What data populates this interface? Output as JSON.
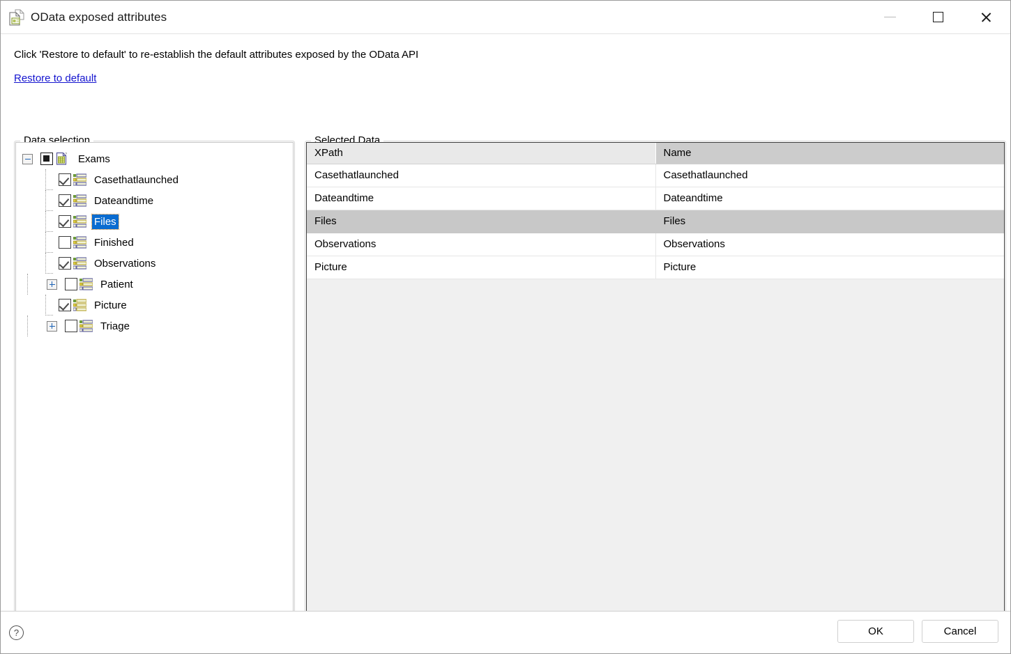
{
  "window": {
    "title": "OData exposed attributes",
    "icon": "document-card-icon",
    "controls": {
      "minimize_label": "Minimize",
      "maximize_label": "Maximize",
      "close_label": "Close"
    }
  },
  "instruction": "Click 'Restore to default' to re-establish the default attributes exposed by the OData API",
  "restore_link": "Restore to default",
  "data_selection": {
    "legend": "Data selection",
    "tree": [
      {
        "label": "Exams",
        "level": 0,
        "twisty": "minus",
        "checkbox": "partial",
        "icon": "table-document-icon",
        "selected": false
      },
      {
        "label": "Casethatlaunched",
        "level": 1,
        "twisty": "none",
        "checkbox": "checked",
        "icon": "attribute-list-icon",
        "selected": false
      },
      {
        "label": "Dateandtime",
        "level": 1,
        "twisty": "none",
        "checkbox": "checked",
        "icon": "attribute-list-icon",
        "selected": false
      },
      {
        "label": "Files",
        "level": 1,
        "twisty": "none",
        "checkbox": "checked",
        "icon": "attribute-list-icon",
        "selected": true
      },
      {
        "label": "Finished",
        "level": 1,
        "twisty": "none",
        "checkbox": "unchecked",
        "icon": "attribute-list-icon",
        "selected": false
      },
      {
        "label": "Observations",
        "level": 1,
        "twisty": "none",
        "checkbox": "checked",
        "icon": "attribute-list-icon",
        "selected": false
      },
      {
        "label": "Patient",
        "level": 1,
        "twisty": "plus",
        "checkbox": "unchecked",
        "icon": "attribute-list-icon",
        "selected": false
      },
      {
        "label": "Picture",
        "level": 1,
        "twisty": "none",
        "checkbox": "checked",
        "icon": "attribute-list-icon",
        "selected": false
      },
      {
        "label": "Triage",
        "level": 1,
        "twisty": "plus",
        "checkbox": "unchecked",
        "icon": "attribute-list-icon",
        "selected": false
      }
    ]
  },
  "selected_data": {
    "legend": "Selected Data",
    "columns": [
      "XPath",
      "Name"
    ],
    "rows": [
      {
        "xpath": "Casethatlaunched",
        "name": "Casethatlaunched",
        "selected": false
      },
      {
        "xpath": "Dateandtime",
        "name": "Dateandtime",
        "selected": false
      },
      {
        "xpath": "Files",
        "name": "Files",
        "selected": true
      },
      {
        "xpath": "Observations",
        "name": "Observations",
        "selected": false
      },
      {
        "xpath": "Picture",
        "name": "Picture",
        "selected": false
      }
    ]
  },
  "footer": {
    "help_icon": "help-circle-icon",
    "ok_label": "OK",
    "cancel_label": "Cancel"
  },
  "colors": {
    "link": "#1414cf",
    "tree_selection": "#0a6cd0",
    "grid_row_selection": "#c8c8c8",
    "header_active": "#e9e9e9",
    "header_inactive": "#cccccc"
  }
}
